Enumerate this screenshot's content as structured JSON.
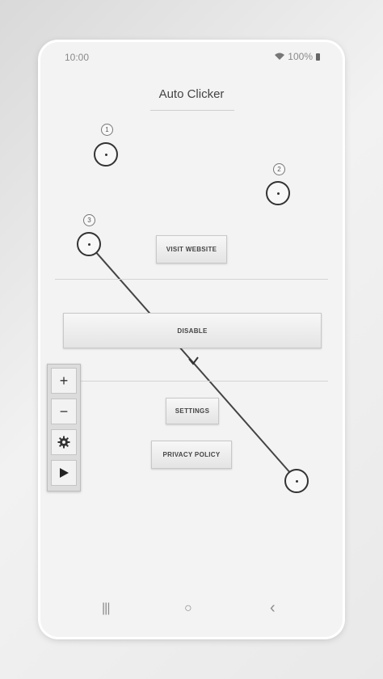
{
  "status_bar": {
    "time": "10:00",
    "battery": "100%"
  },
  "app": {
    "title": "Auto Clicker"
  },
  "buttons": {
    "visit_website": "VISIT WEBSITE",
    "disable": "DISABLE",
    "settings": "SETTINGS",
    "privacy_policy": "PRIVACY POLICY"
  },
  "targets": [
    {
      "number": "1"
    },
    {
      "number": "2"
    },
    {
      "number": "3"
    }
  ],
  "toolbar": {
    "add_symbol": "+",
    "remove_symbol": "−",
    "settings_icon": "gear-icon",
    "play_icon": "play-icon"
  },
  "navbar": {
    "recents_symbol": "|||",
    "home_symbol": "○",
    "back_symbol": "‹"
  }
}
